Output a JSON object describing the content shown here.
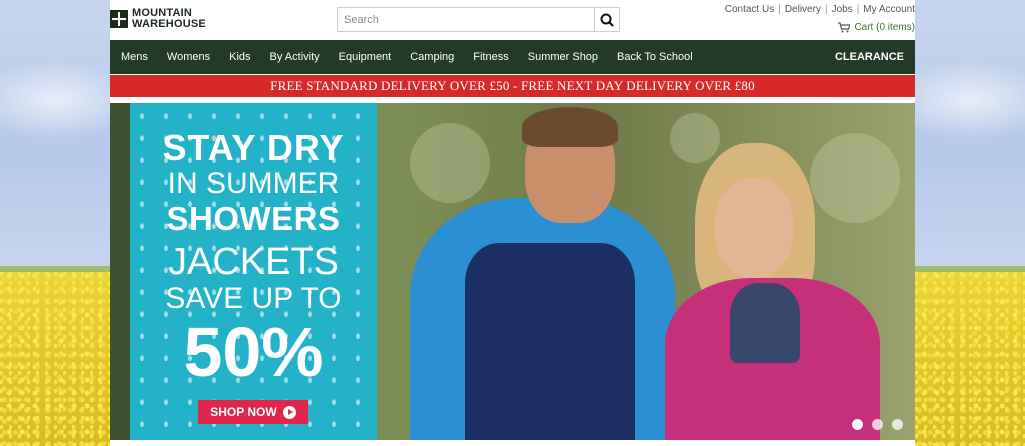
{
  "header": {
    "logo_line1": "MOUNTAIN",
    "logo_line2": "WAREHOUSE",
    "search": {
      "placeholder": "Search",
      "value": ""
    },
    "links": [
      "Contact Us",
      "Delivery",
      "Jobs",
      "My Account"
    ],
    "cart_label": "Cart (0 items)"
  },
  "nav": {
    "items": [
      "Mens",
      "Womens",
      "Kids",
      "By Activity",
      "Equipment",
      "Camping",
      "Fitness",
      "Summer Shop",
      "Back To School"
    ],
    "clearance": "CLEARANCE"
  },
  "promo_text": "FREE STANDARD DELIVERY OVER £50 - FREE NEXT DAY DELIVERY OVER £80",
  "hero": {
    "line1": "STAY DRY",
    "line2": "IN SUMMER",
    "line3": "SHOWERS",
    "line4": "JACKETS",
    "line5": "SAVE UP TO",
    "line6": "50%",
    "button": "SHOP NOW",
    "slides": 3,
    "active_slide": 1
  },
  "colors": {
    "nav_bg": "#223a27",
    "promo_bg": "#d62a2a",
    "panel_bg": "#24b2c9",
    "shop_button": "#e0264a",
    "cart_text": "#3a7a2a"
  },
  "icons": [
    "search-icon",
    "cart-icon",
    "play-icon",
    "logo-cross-icon"
  ]
}
